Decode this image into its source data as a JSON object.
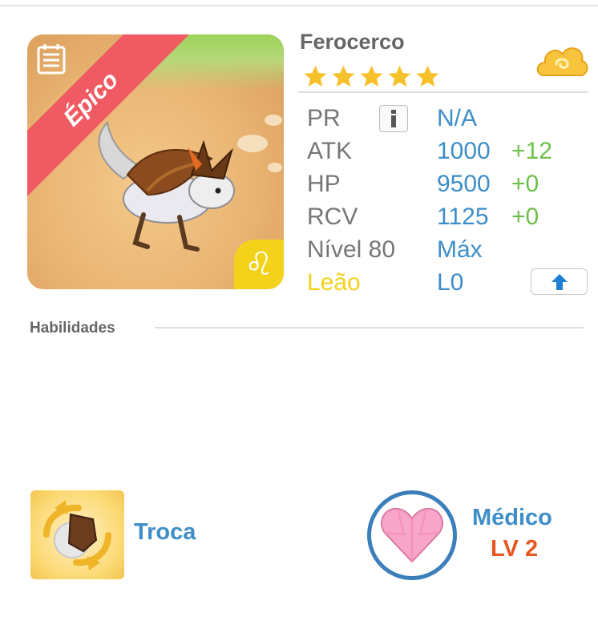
{
  "pet": {
    "name": "Ferocerco",
    "rarity": "Épico",
    "stars": 5,
    "element_icon": "cloud-icon",
    "zodiac_symbol": "♌"
  },
  "stats": {
    "pr": {
      "label": "PR",
      "value": "N/A"
    },
    "atk": {
      "label": "ATK",
      "value": "1000",
      "bonus": "+12"
    },
    "hp": {
      "label": "HP",
      "value": "9500",
      "bonus": "+0"
    },
    "rcv": {
      "label": "RCV",
      "value": "1125",
      "bonus": "+0"
    },
    "level": {
      "label": "Nível 80",
      "value": "Máx"
    },
    "zodiac": {
      "label": "Leão",
      "value": "L0"
    }
  },
  "abilities": {
    "title": "Habilidades",
    "skill": {
      "name": "Troca"
    },
    "leader": {
      "name": "Médico",
      "level": "LV 2"
    }
  },
  "colors": {
    "value_blue": "#3d8ec9",
    "bonus_green": "#6cc04a",
    "zodiac_yellow": "#f2d21b",
    "rarity_red": "#ef5a63",
    "level_orange": "#e8551e"
  }
}
